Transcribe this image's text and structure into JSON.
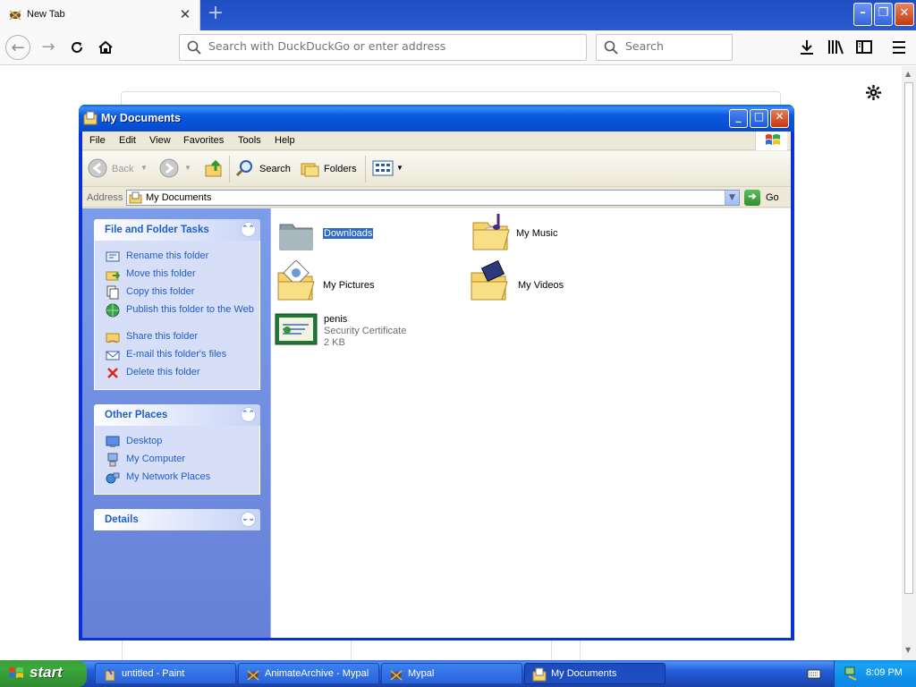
{
  "browser": {
    "tab_title": "New Tab",
    "tab_close": "✕",
    "new_tab": "+",
    "url_placeholder": "Search with DuckDuckGo or enter address",
    "search_placeholder": "Search"
  },
  "explorer": {
    "title": "My Documents",
    "menu": [
      "File",
      "Edit",
      "View",
      "Favorites",
      "Tools",
      "Help"
    ],
    "toolbar": {
      "back": "Back",
      "search": "Search",
      "folders": "Folders"
    },
    "address": {
      "label": "Address",
      "value": "My Documents",
      "go": "Go"
    },
    "panels": {
      "tasks": {
        "title": "File and Folder Tasks",
        "items": [
          "Rename this folder",
          "Move this folder",
          "Copy this folder",
          "Publish this folder to the Web",
          "Share this folder",
          "E-mail this folder's files",
          "Delete this folder"
        ]
      },
      "places": {
        "title": "Other Places",
        "items": [
          "Desktop",
          "My Computer",
          "My Network Places"
        ]
      },
      "details": {
        "title": "Details"
      }
    },
    "files": [
      {
        "name": "Downloads"
      },
      {
        "name": "My Music"
      },
      {
        "name": "My Pictures"
      },
      {
        "name": "My Videos"
      },
      {
        "name": "penis",
        "type": "Security Certificate",
        "size": "2 KB"
      }
    ]
  },
  "taskbar": {
    "start": "start",
    "tasks": [
      "untitled - Paint",
      "AnimateArchive - Mypal",
      "Mypal",
      "My Documents"
    ],
    "clock": "8:09 PM"
  }
}
